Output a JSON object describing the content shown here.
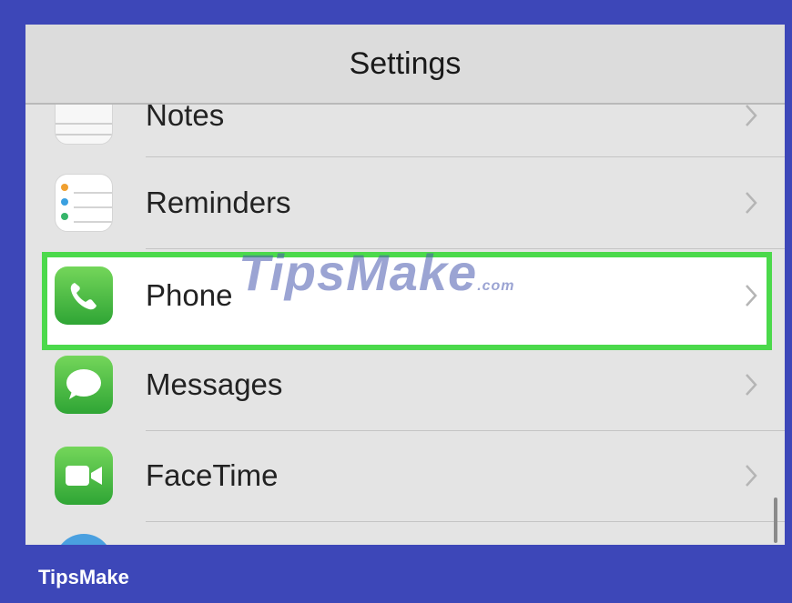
{
  "navbar": {
    "title": "Settings"
  },
  "rows": [
    {
      "label": "Notes",
      "icon": "notes-icon"
    },
    {
      "label": "Reminders",
      "icon": "reminders-icon"
    },
    {
      "label": "Phone",
      "icon": "phone-icon"
    },
    {
      "label": "Messages",
      "icon": "messages-icon"
    },
    {
      "label": "FaceTime",
      "icon": "facetime-icon"
    }
  ],
  "watermark": {
    "main": "TipsMake",
    "suffix": ".com"
  },
  "brand": "TipsMake",
  "colors": {
    "frame": "#3d47b8",
    "highlight": "#4bd94b",
    "icon_green": "#3cb043"
  }
}
